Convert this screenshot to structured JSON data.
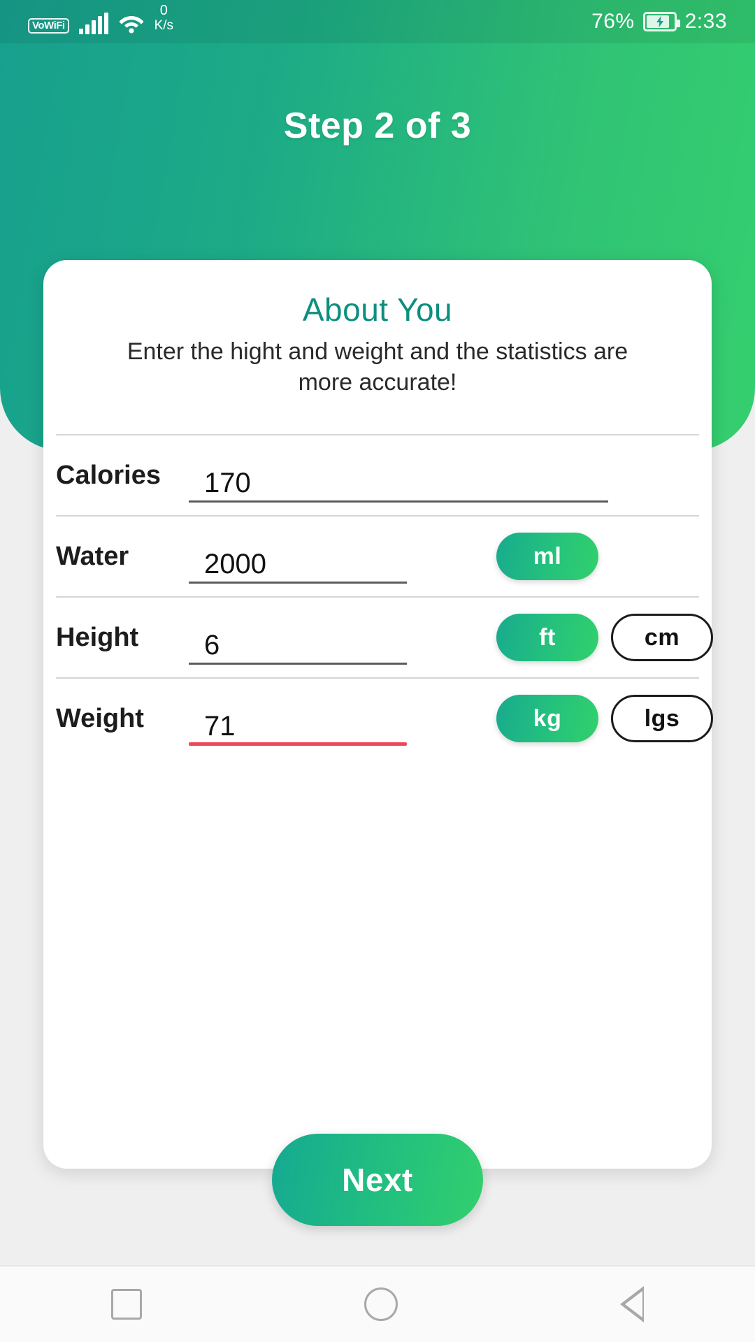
{
  "status_bar": {
    "vowifi_label": "VoWiFi",
    "wifi_icon": "wifi-icon",
    "signal_icon": "signal-bars-icon",
    "net_speed_value": "0",
    "net_speed_unit": "K/s",
    "battery_percent": "76%",
    "battery_icon": "battery-charging-icon",
    "clock": "2:33"
  },
  "header": {
    "step_title": "Step 2 of 3"
  },
  "card": {
    "title": "About You",
    "subtitle": "Enter the hight and weight and the statistics are more accurate!",
    "fields": [
      {
        "label": "Calories",
        "value": "170",
        "placeholder": "",
        "underline_state": "normal",
        "units": []
      },
      {
        "label": "Water",
        "value": "2000",
        "placeholder": "",
        "underline_state": "normal",
        "units": [
          {
            "label": "ml",
            "selected": true
          }
        ]
      },
      {
        "label": "Height",
        "value": "6",
        "placeholder": "",
        "underline_state": "normal",
        "units": [
          {
            "label": "ft",
            "selected": true
          },
          {
            "label": "cm",
            "selected": false
          }
        ]
      },
      {
        "label": "Weight",
        "value": "71",
        "placeholder": "",
        "underline_state": "error",
        "units": [
          {
            "label": "kg",
            "selected": true
          },
          {
            "label": "lgs",
            "selected": false
          }
        ]
      }
    ]
  },
  "actions": {
    "next_label": "Next"
  },
  "navbar": {
    "recents_icon": "square-recents-icon",
    "home_icon": "circle-home-icon",
    "back_icon": "triangle-back-icon"
  },
  "colors": {
    "header_teal": "#17a08e",
    "header_green": "#35cf6e",
    "card_title_teal": "#0e8f7e",
    "error_red": "#f0465c",
    "pill_outline": "#1b1b1b"
  }
}
